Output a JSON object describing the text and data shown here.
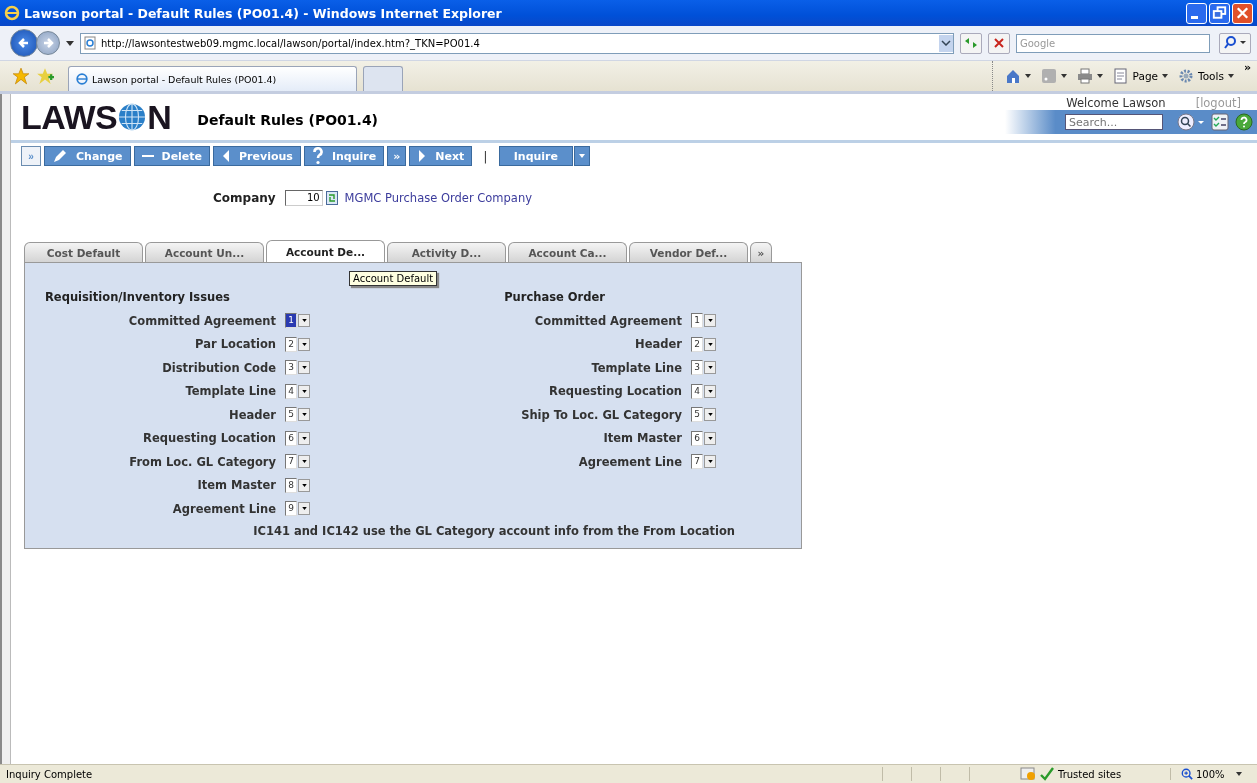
{
  "window": {
    "title": "Lawson portal - Default Rules (PO01.4) - Windows Internet Explorer"
  },
  "address_bar": {
    "url": "http://lawsontestweb09.mgmc.local/lawson/portal/index.htm?_TKN=PO01.4",
    "search_placeholder": "Google"
  },
  "browser_tabs": [
    {
      "label": "Lawson portal - Default Rules (PO01.4)",
      "selected": true
    },
    {
      "selected": false
    }
  ],
  "command_bar": [
    {
      "kind": "icon"
    },
    {
      "kind": "icon"
    },
    {
      "kind": "icon"
    },
    {
      "kind": "menu",
      "label": "Page"
    },
    {
      "kind": "menu",
      "label": "Tools"
    },
    {
      "kind": "more",
      "label": "»"
    }
  ],
  "portal": {
    "logo": {
      "before": "LAWS",
      "after": "N"
    },
    "page_title": "Default Rules (PO01.4)",
    "welcome": "Welcome Lawson",
    "logout": "[logout]",
    "search_placeholder": "Search..."
  },
  "toolbar": [
    {
      "kind": "toggle",
      "label": "»"
    },
    {
      "kind": "action",
      "label": "Change"
    },
    {
      "kind": "action",
      "label": "Delete"
    },
    {
      "kind": "action",
      "label": "Previous"
    },
    {
      "kind": "action",
      "label": "Inquire"
    },
    {
      "kind": "more",
      "label": "»"
    },
    {
      "kind": "action",
      "label": "Next"
    },
    {
      "kind": "separator",
      "label": "|"
    },
    {
      "kind": "dropdown",
      "label": "Inquire"
    }
  ],
  "company": {
    "label": "Company",
    "value": "10",
    "description": "MGMC Purchase Order Company"
  },
  "tabs": [
    {
      "label": "Cost Default",
      "selected": false
    },
    {
      "label": "Account Un...",
      "selected": false
    },
    {
      "label": "Account De...",
      "selected": true
    },
    {
      "label": "Activity D...",
      "selected": false
    },
    {
      "label": "Account Ca...",
      "selected": false
    },
    {
      "label": "Vendor Def...",
      "selected": false
    },
    {
      "label": "»",
      "selected": false
    }
  ],
  "tooltip": "Account Default",
  "sections": [
    {
      "heading": "Requisition/Inventory Issues",
      "rows": [
        {
          "label": "Committed Agreement",
          "value": "1",
          "focused": true
        },
        {
          "label": "Par Location",
          "value": "2",
          "focused": false
        },
        {
          "label": "Distribution Code",
          "value": "3",
          "focused": false
        },
        {
          "label": "Template Line",
          "value": "4",
          "focused": false
        },
        {
          "label": "Header",
          "value": "5",
          "focused": false
        },
        {
          "label": "Requesting Location",
          "value": "6",
          "focused": false
        },
        {
          "label": "From Loc. GL Category",
          "value": "7",
          "focused": false
        },
        {
          "label": "Item Master",
          "value": "8",
          "focused": false
        },
        {
          "label": "Agreement Line",
          "value": "9",
          "focused": false
        }
      ]
    },
    {
      "heading": "Purchase Order",
      "rows": [
        {
          "label": "Committed Agreement",
          "value": "1",
          "focused": false
        },
        {
          "label": "Header",
          "value": "2",
          "focused": false
        },
        {
          "label": "Template Line",
          "value": "3",
          "focused": false
        },
        {
          "label": "Requesting Location",
          "value": "4",
          "focused": false
        },
        {
          "label": "Ship To Loc. GL Category",
          "value": "5",
          "focused": false
        },
        {
          "label": "Item Master",
          "value": "6",
          "focused": false
        },
        {
          "label": "Agreement Line",
          "value": "7",
          "focused": false
        }
      ]
    }
  ],
  "note": "IC141 and IC142 use the GL Category account info from the From Location",
  "status_bar": {
    "text": "Inquiry Complete",
    "zone": "Trusted sites",
    "zoom": "100%"
  }
}
